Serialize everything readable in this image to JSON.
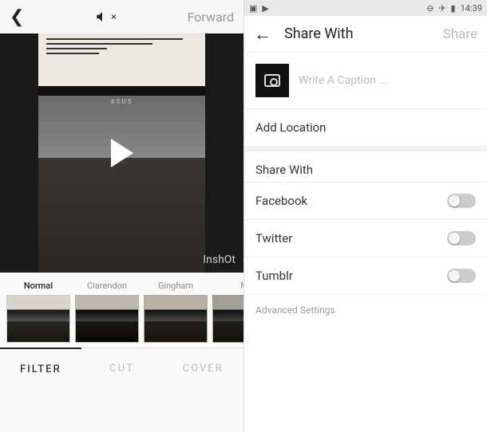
{
  "left": {
    "header": {
      "forward_label": "Forward"
    },
    "video": {
      "watermark": "InshOt",
      "logo": "ASUS"
    },
    "filters": [
      {
        "label": "Normal",
        "selected": true
      },
      {
        "label": "Clarendon",
        "selected": false
      },
      {
        "label": "Gingham",
        "selected": false
      },
      {
        "label": "M",
        "selected": false
      }
    ],
    "tabs": {
      "filter": "FILTER",
      "cut": "CUT",
      "cover": "COVER"
    }
  },
  "right": {
    "statusbar": {
      "time": "14:39"
    },
    "header": {
      "title": "Share With",
      "share_button": "Share"
    },
    "caption_placeholder": "Write A Caption ...",
    "add_location": "Add Location",
    "share_with_label": "Share With",
    "options": [
      {
        "label": "Facebook",
        "on": false
      },
      {
        "label": "Twitter",
        "on": false
      },
      {
        "label": "Tumblr",
        "on": false
      }
    ],
    "advanced": "Advanced Settings"
  }
}
